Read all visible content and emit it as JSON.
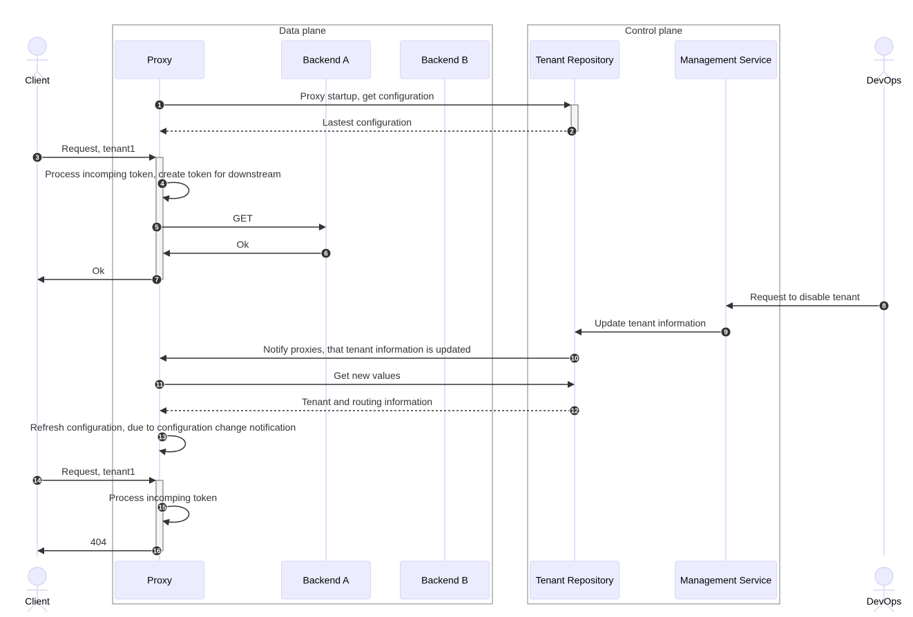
{
  "diagram": {
    "type": "sequence",
    "colors": {
      "participant_fill": "#ECECFF",
      "participant_border": "#DCD6F5",
      "lifeline": "#DCD6F5",
      "box_border": "#AAAAAA",
      "message": "#333333",
      "activation_fill": "#F4F4F4",
      "activation_border": "#666666",
      "sequence_badge": "#333333"
    },
    "boxes": [
      {
        "id": "data-plane",
        "title": "Data plane",
        "members": [
          "proxy",
          "backend-a",
          "backend-b"
        ]
      },
      {
        "id": "control-plane",
        "title": "Control plane",
        "members": [
          "tenant-repo",
          "mgmt-service"
        ]
      }
    ],
    "participants": [
      {
        "id": "client",
        "label": "Client",
        "kind": "actor"
      },
      {
        "id": "proxy",
        "label": "Proxy",
        "kind": "participant"
      },
      {
        "id": "backend-a",
        "label": "Backend A",
        "kind": "participant"
      },
      {
        "id": "backend-b",
        "label": "Backend B",
        "kind": "participant"
      },
      {
        "id": "tenant-repo",
        "label": "Tenant Repository",
        "kind": "participant"
      },
      {
        "id": "mgmt-service",
        "label": "Management Service",
        "kind": "participant"
      },
      {
        "id": "devops",
        "label": "DevOps",
        "kind": "actor"
      }
    ],
    "messages": [
      {
        "n": "1",
        "from": "proxy",
        "to": "tenant-repo",
        "text": "Proxy startup, get configuration",
        "style": "solid"
      },
      {
        "n": "2",
        "from": "tenant-repo",
        "to": "proxy",
        "text": "Lastest configuration",
        "style": "dotted"
      },
      {
        "n": "3",
        "from": "client",
        "to": "proxy",
        "text": "Request, tenant1",
        "style": "solid"
      },
      {
        "n": "4",
        "from": "proxy",
        "to": "proxy",
        "text": "Process incomping token, create token for downstream",
        "style": "solid"
      },
      {
        "n": "5",
        "from": "proxy",
        "to": "backend-a",
        "text": "GET",
        "style": "solid"
      },
      {
        "n": "6",
        "from": "backend-a",
        "to": "proxy",
        "text": "Ok",
        "style": "solid"
      },
      {
        "n": "7",
        "from": "proxy",
        "to": "client",
        "text": "Ok",
        "style": "solid"
      },
      {
        "n": "8",
        "from": "devops",
        "to": "mgmt-service",
        "text": "Request to disable tenant",
        "style": "solid"
      },
      {
        "n": "9",
        "from": "mgmt-service",
        "to": "tenant-repo",
        "text": "Update tenant information",
        "style": "solid"
      },
      {
        "n": "10",
        "from": "tenant-repo",
        "to": "proxy",
        "text": "Notify proxies, that tenant information is updated",
        "style": "solid"
      },
      {
        "n": "11",
        "from": "proxy",
        "to": "tenant-repo",
        "text": "Get new values",
        "style": "solid"
      },
      {
        "n": "12",
        "from": "tenant-repo",
        "to": "proxy",
        "text": "Tenant and routing information",
        "style": "dotted"
      },
      {
        "n": "13",
        "from": "proxy",
        "to": "proxy",
        "text": "Refresh configuration, due to configuration change notification",
        "style": "solid"
      },
      {
        "n": "14",
        "from": "client",
        "to": "proxy",
        "text": "Request, tenant1",
        "style": "solid"
      },
      {
        "n": "15",
        "from": "proxy",
        "to": "proxy",
        "text": "Process incomping token",
        "style": "solid"
      },
      {
        "n": "16",
        "from": "proxy",
        "to": "client",
        "text": "404",
        "style": "solid"
      }
    ],
    "activations": [
      {
        "participant": "tenant-repo",
        "from_msg": "1",
        "to_msg": "2"
      },
      {
        "participant": "proxy",
        "from_msg": "3",
        "to_msg": "7"
      },
      {
        "participant": "proxy",
        "from_msg": "14",
        "to_msg": "16"
      }
    ]
  }
}
